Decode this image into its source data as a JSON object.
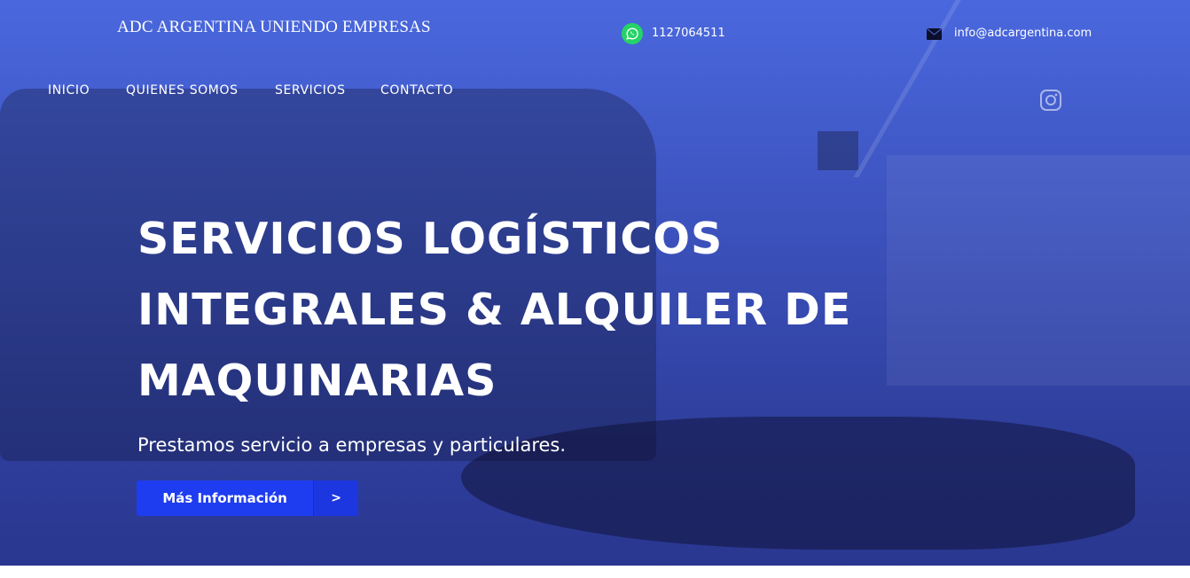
{
  "header": {
    "site_title": "ADC ARGENTINA UNIENDO EMPRESAS",
    "phone": "1127064511",
    "email": "info@adcargentina.com",
    "phone_icon": "whatsapp-icon",
    "email_icon": "envelope-icon",
    "social_icon": "instagram-icon"
  },
  "nav": {
    "items": [
      "INICIO",
      "QUIENES SOMOS",
      "SERVICIOS",
      "CONTACTO"
    ]
  },
  "hero": {
    "headline_lines": [
      "SERVICIOS LOGÍSTICOS",
      "INTEGRALES & ALQUILER DE",
      "MAQUINARIAS"
    ],
    "subtitle": "Prestamos servicio a empresas y particulares.",
    "cta_label": "Más Información",
    "cta_arrow": ">"
  },
  "colors": {
    "overlay": "#4a68de",
    "cta": "#1f3df0",
    "whatsapp": "#25d366"
  }
}
